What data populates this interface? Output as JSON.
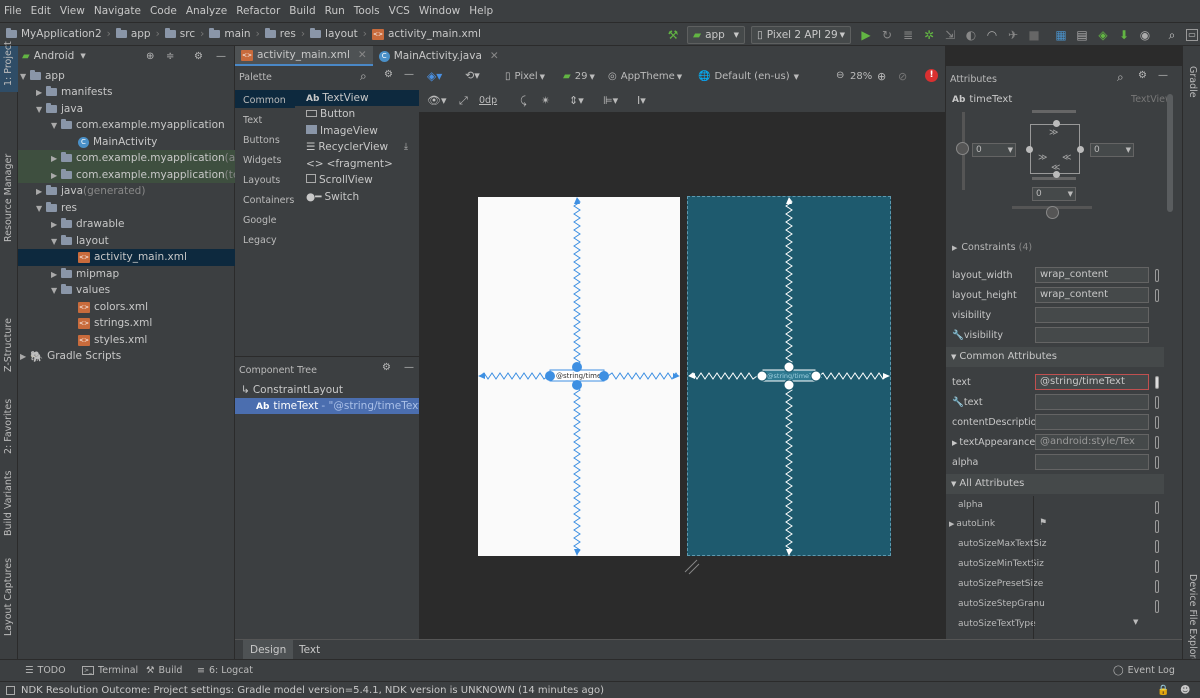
{
  "menu": [
    "File",
    "Edit",
    "View",
    "Navigate",
    "Code",
    "Analyze",
    "Refactor",
    "Build",
    "Run",
    "Tools",
    "VCS",
    "Window",
    "Help"
  ],
  "breadcrumb": [
    "MyApplication2",
    "app",
    "src",
    "main",
    "res",
    "layout",
    "activity_main.xml"
  ],
  "toolbar": {
    "run_config": "app",
    "device": "Pixel 2 API 29"
  },
  "left_strip": [
    "1: Project",
    "Resource Manager",
    "Z-Structure",
    "2: Favorites",
    "Build Variants",
    "Layout Captures"
  ],
  "right_strip": [
    "Gradle",
    "Device File Explorer"
  ],
  "project": {
    "view": "Android",
    "tree": [
      {
        "label": "app",
        "suffix": ""
      },
      {
        "label": "manifests",
        "suffix": ""
      },
      {
        "label": "java",
        "suffix": ""
      },
      {
        "label": "com.example.myapplication",
        "suffix": ""
      },
      {
        "label": "MainActivity",
        "suffix": ""
      },
      {
        "label": "com.example.myapplication",
        "suffix": " (andro"
      },
      {
        "label": "com.example.myapplication",
        "suffix": " (test)"
      },
      {
        "label": "java",
        "suffix": " (generated)"
      },
      {
        "label": "res",
        "suffix": ""
      },
      {
        "label": "drawable",
        "suffix": ""
      },
      {
        "label": "layout",
        "suffix": ""
      },
      {
        "label": "activity_main.xml",
        "suffix": ""
      },
      {
        "label": "mipmap",
        "suffix": ""
      },
      {
        "label": "values",
        "suffix": ""
      },
      {
        "label": "colors.xml",
        "suffix": ""
      },
      {
        "label": "strings.xml",
        "suffix": ""
      },
      {
        "label": "styles.xml",
        "suffix": ""
      },
      {
        "label": "Gradle Scripts",
        "suffix": ""
      }
    ]
  },
  "editor_tabs": [
    "activity_main.xml",
    "MainActivity.java"
  ],
  "palette": {
    "title": "Palette",
    "categories": [
      "Common",
      "Text",
      "Buttons",
      "Widgets",
      "Layouts",
      "Containers",
      "Google",
      "Legacy"
    ],
    "items": [
      "TextView",
      "Button",
      "ImageView",
      "RecyclerView",
      "<fragment>",
      "ScrollView",
      "Switch"
    ]
  },
  "component_tree": {
    "title": "Component Tree",
    "root": "ConstraintLayout",
    "child": "timeText",
    "child_hint": "- \"@string/timeText\""
  },
  "design_toolbar": {
    "device": "Pixel",
    "api": "29",
    "theme": "AppTheme",
    "locale": "Default (en-us)",
    "zoom": "28%",
    "margin": "0dp"
  },
  "blueprint": {
    "text_label": "@string/timeTe",
    "text_label_dark": "@string/timeText"
  },
  "attributes": {
    "title": "Attributes",
    "widget": "timeText",
    "widget_type": "TextView",
    "margins": {
      "left": "0",
      "right": "0",
      "bottom": "0"
    },
    "constraints": "Constraints",
    "constraints_count": "(4)",
    "rows": [
      {
        "label": "layout_width",
        "value": "wrap_content"
      },
      {
        "label": "layout_height",
        "value": "wrap_content"
      },
      {
        "label": "visibility",
        "value": ""
      },
      {
        "label": "visibility",
        "value": ""
      }
    ],
    "common_section": "Common Attributes",
    "common": [
      {
        "label": "text",
        "value": "@string/timeText"
      },
      {
        "label": "text",
        "value": ""
      },
      {
        "label": "contentDescription",
        "value": ""
      },
      {
        "label": "textAppearance",
        "value": "@android:style/Tex"
      },
      {
        "label": "alpha",
        "value": ""
      }
    ],
    "all_section": "All Attributes",
    "all": [
      "alpha",
      "autoLink",
      "autoSizeMaxTextSiz",
      "autoSizeMinTextSiz",
      "autoSizePresetSize",
      "autoSizeStepGranu",
      "autoSizeTextType"
    ]
  },
  "bottom_tabs": [
    "Design",
    "Text"
  ],
  "tool_windows": [
    "TODO",
    "Terminal",
    "Build",
    "6: Logcat",
    "Event Log"
  ],
  "status": "NDK Resolution Outcome: Project settings: Gradle model version=5.4.1, NDK version is UNKNOWN (14 minutes ago)",
  "colors": {
    "accent": "#3d8fe2",
    "selection": "#0d293e",
    "canvas_dark": "#1e5a6e",
    "error": "#d93030"
  }
}
